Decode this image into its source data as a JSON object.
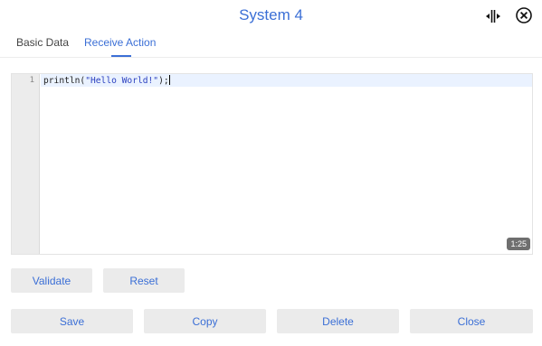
{
  "dialog": {
    "title": "System 4"
  },
  "tabs": [
    {
      "label": "Basic Data",
      "active": false
    },
    {
      "label": "Receive Action",
      "active": true
    }
  ],
  "editor": {
    "line_number": "1",
    "code_prefix": "println(",
    "code_string": "\"Hello World!\"",
    "code_suffix": ");",
    "cursor_position": "1:25"
  },
  "buttons": {
    "validate": "Validate",
    "reset": "Reset",
    "save": "Save",
    "copy": "Copy",
    "delete": "Delete",
    "close": "Close"
  },
  "colors": {
    "accent": "#3b6fd6",
    "button_bg": "#ebebeb",
    "gutter_bg": "#ececec",
    "active_line_bg": "#eaf2ff"
  },
  "icons": {
    "resize": "split-resize-icon",
    "close": "circle-x-icon"
  }
}
